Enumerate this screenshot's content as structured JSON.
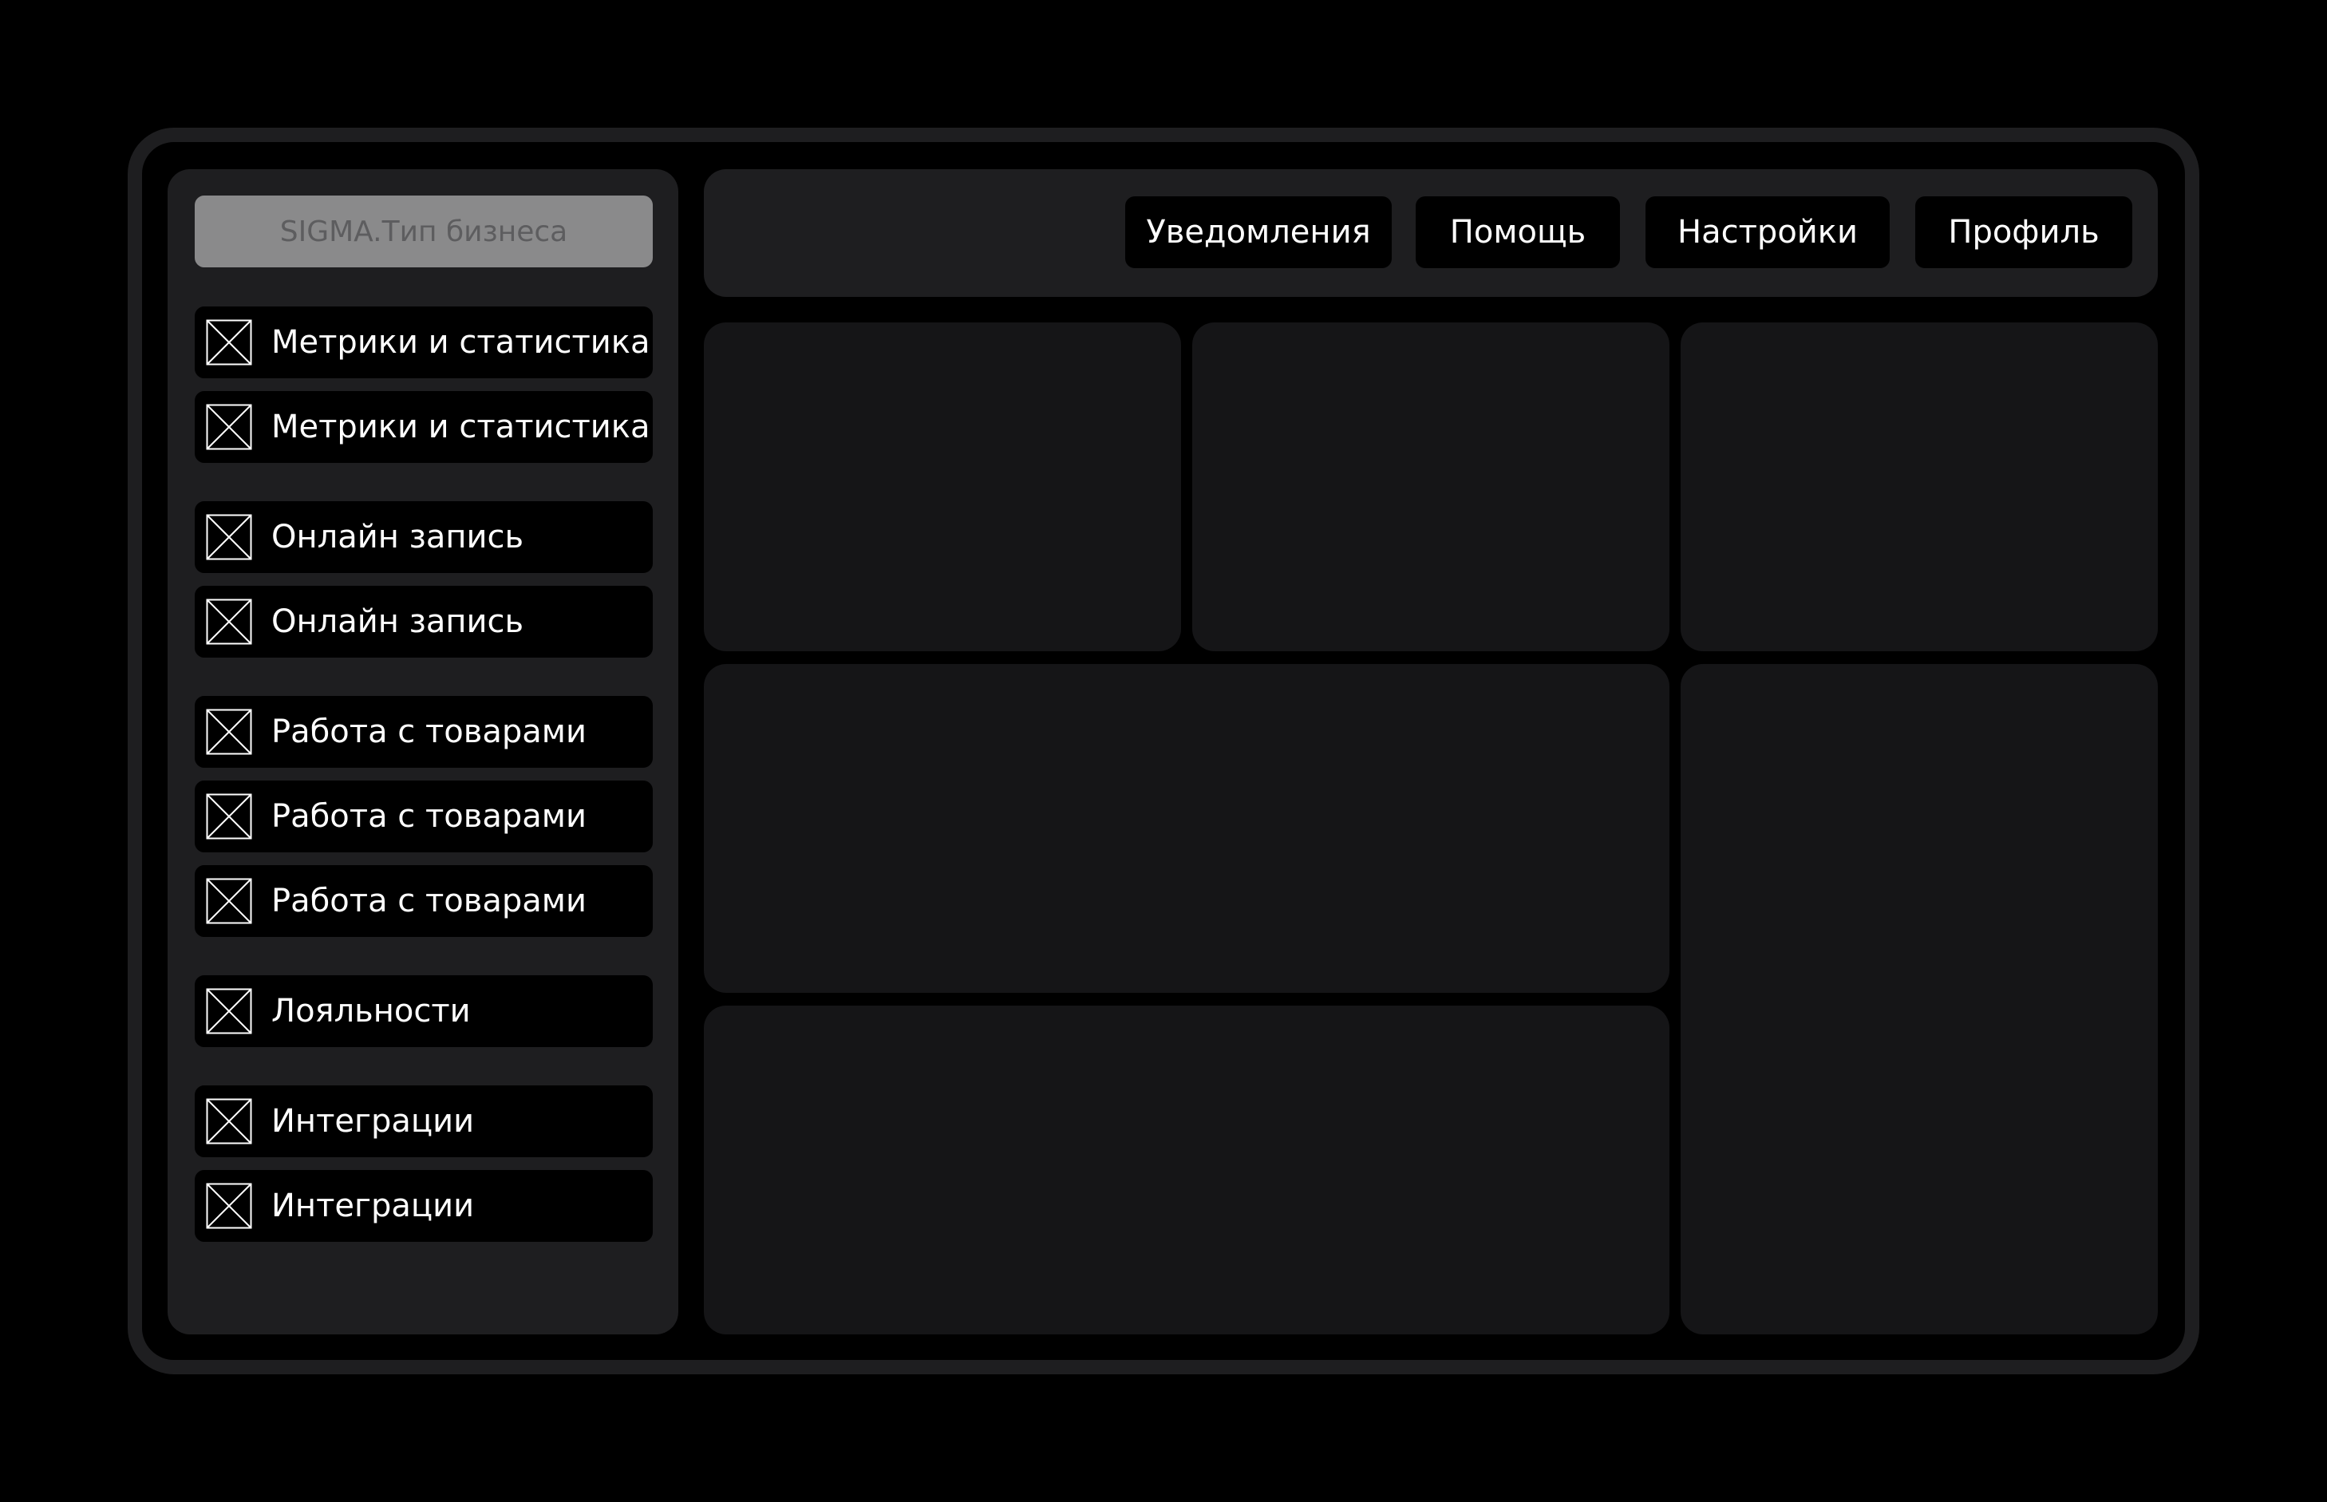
{
  "sidebar": {
    "business_select": "SIGMA.Тип бизнеса",
    "items": [
      {
        "label": "Метрики и статистика",
        "icon": "image-placeholder-icon"
      },
      {
        "label": "Метрики и статистика",
        "icon": "image-placeholder-icon"
      },
      {
        "label": "Онлайн запись",
        "icon": "image-placeholder-icon"
      },
      {
        "label": "Онлайн запись",
        "icon": "image-placeholder-icon"
      },
      {
        "label": "Работа с товарами",
        "icon": "image-placeholder-icon"
      },
      {
        "label": "Работа с товарами",
        "icon": "image-placeholder-icon"
      },
      {
        "label": "Работа с товарами",
        "icon": "image-placeholder-icon"
      },
      {
        "label": "Лояльности",
        "icon": "image-placeholder-icon"
      },
      {
        "label": "Интеграции",
        "icon": "image-placeholder-icon"
      },
      {
        "label": "Интеграции",
        "icon": "image-placeholder-icon"
      }
    ]
  },
  "header": {
    "notifications_label": "Уведомления",
    "help_label": "Помощь",
    "settings_label": "Настройки",
    "profile_label": "Профиль"
  },
  "colors": {
    "background": "#000000",
    "panel": "#1e1e20",
    "card": "#151517",
    "button": "#000000",
    "select": "#8a8a8b",
    "text": "#ffffff"
  }
}
